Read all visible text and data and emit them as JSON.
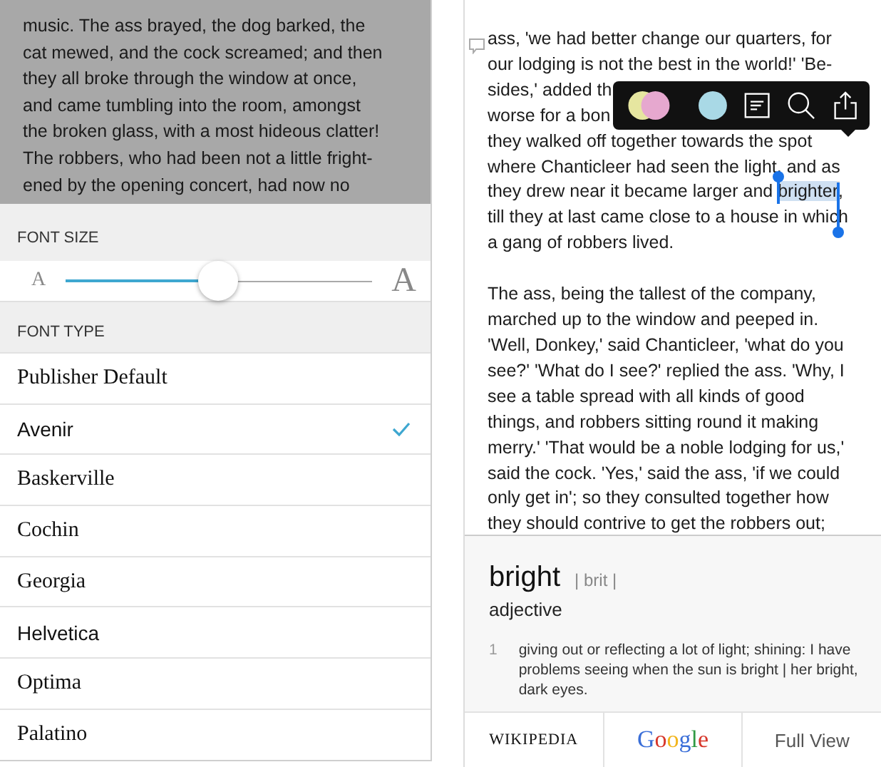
{
  "left_text": {
    "lines": [
      "music. The ass brayed, the dog barked, the",
      "cat mewed, and the cock screamed; and then",
      "they all broke through the window at once,",
      "and came tumbling into the room, amongst",
      "the broken glass, with a most hideous clatter!",
      "The robbers, who had been not a little fright-",
      "ened by the opening concert, had now no"
    ]
  },
  "font_size": {
    "label": "FONT SIZE",
    "small_glyph": "A",
    "large_glyph": "A",
    "level": 0.5
  },
  "font_type": {
    "label": "FONT TYPE",
    "fonts": [
      {
        "name": "Publisher Default",
        "kind": "serif",
        "selected": false
      },
      {
        "name": "Avenir",
        "kind": "sans",
        "selected": true
      },
      {
        "name": "Baskerville",
        "kind": "serif",
        "selected": false
      },
      {
        "name": "Cochin",
        "kind": "serif",
        "selected": false
      },
      {
        "name": "Georgia",
        "kind": "serif",
        "selected": false
      },
      {
        "name": "Helvetica",
        "kind": "sans",
        "selected": false
      },
      {
        "name": "Optima",
        "kind": "serif",
        "selected": false
      },
      {
        "name": "Palatino",
        "kind": "serif",
        "selected": false
      }
    ]
  },
  "reader": {
    "paragraphs": [
      {
        "lines": [
          "ass, 'we had better change our quarters, for",
          "our lodging is not the best in the world!' 'Be-",
          "sides,' added th",
          "worse for a bon",
          "they walked off together towards the spot",
          "where Chanticleer had seen the light, and as",
          {
            "parts": [
              {
                "text": "they drew near it became larger and ",
                "selected": false
              },
              {
                "text": "brighter",
                "selected": true
              },
              {
                "text": ",",
                "selected": false
              }
            ]
          },
          "till they at last came close to a house in which",
          "a gang of robbers lived."
        ]
      },
      {
        "lines": [
          "The ass, being the tallest of the company,",
          "marched up to the window and peeped in.",
          "'Well, Donkey,' said Chanticleer, 'what do you",
          "see?' 'What do I see?' replied the ass. 'Why, I",
          "see a table spread with all kinds of good",
          "things, and robbers sitting round it making",
          "merry.' 'That would be a noble lodging for us,'",
          "said the cock. 'Yes,' said the ass, 'if we could",
          "only get in'; so they consulted together how",
          "they should contrive to get the robbers out;"
        ]
      }
    ]
  },
  "dictionary": {
    "word": "bright",
    "pronunciation": "| brit |",
    "part_of_speech": "adjective",
    "senses": [
      {
        "number": "1",
        "text": "giving out or reflecting a lot of light; shining: I have problems seeing when the sun is bright | her bright, dark eyes."
      }
    ],
    "buttons": [
      {
        "kind": "wikipedia",
        "label": "WIKIPEDIA"
      },
      {
        "kind": "google",
        "label": "Google"
      },
      {
        "kind": "text",
        "label": "Full View"
      }
    ]
  }
}
